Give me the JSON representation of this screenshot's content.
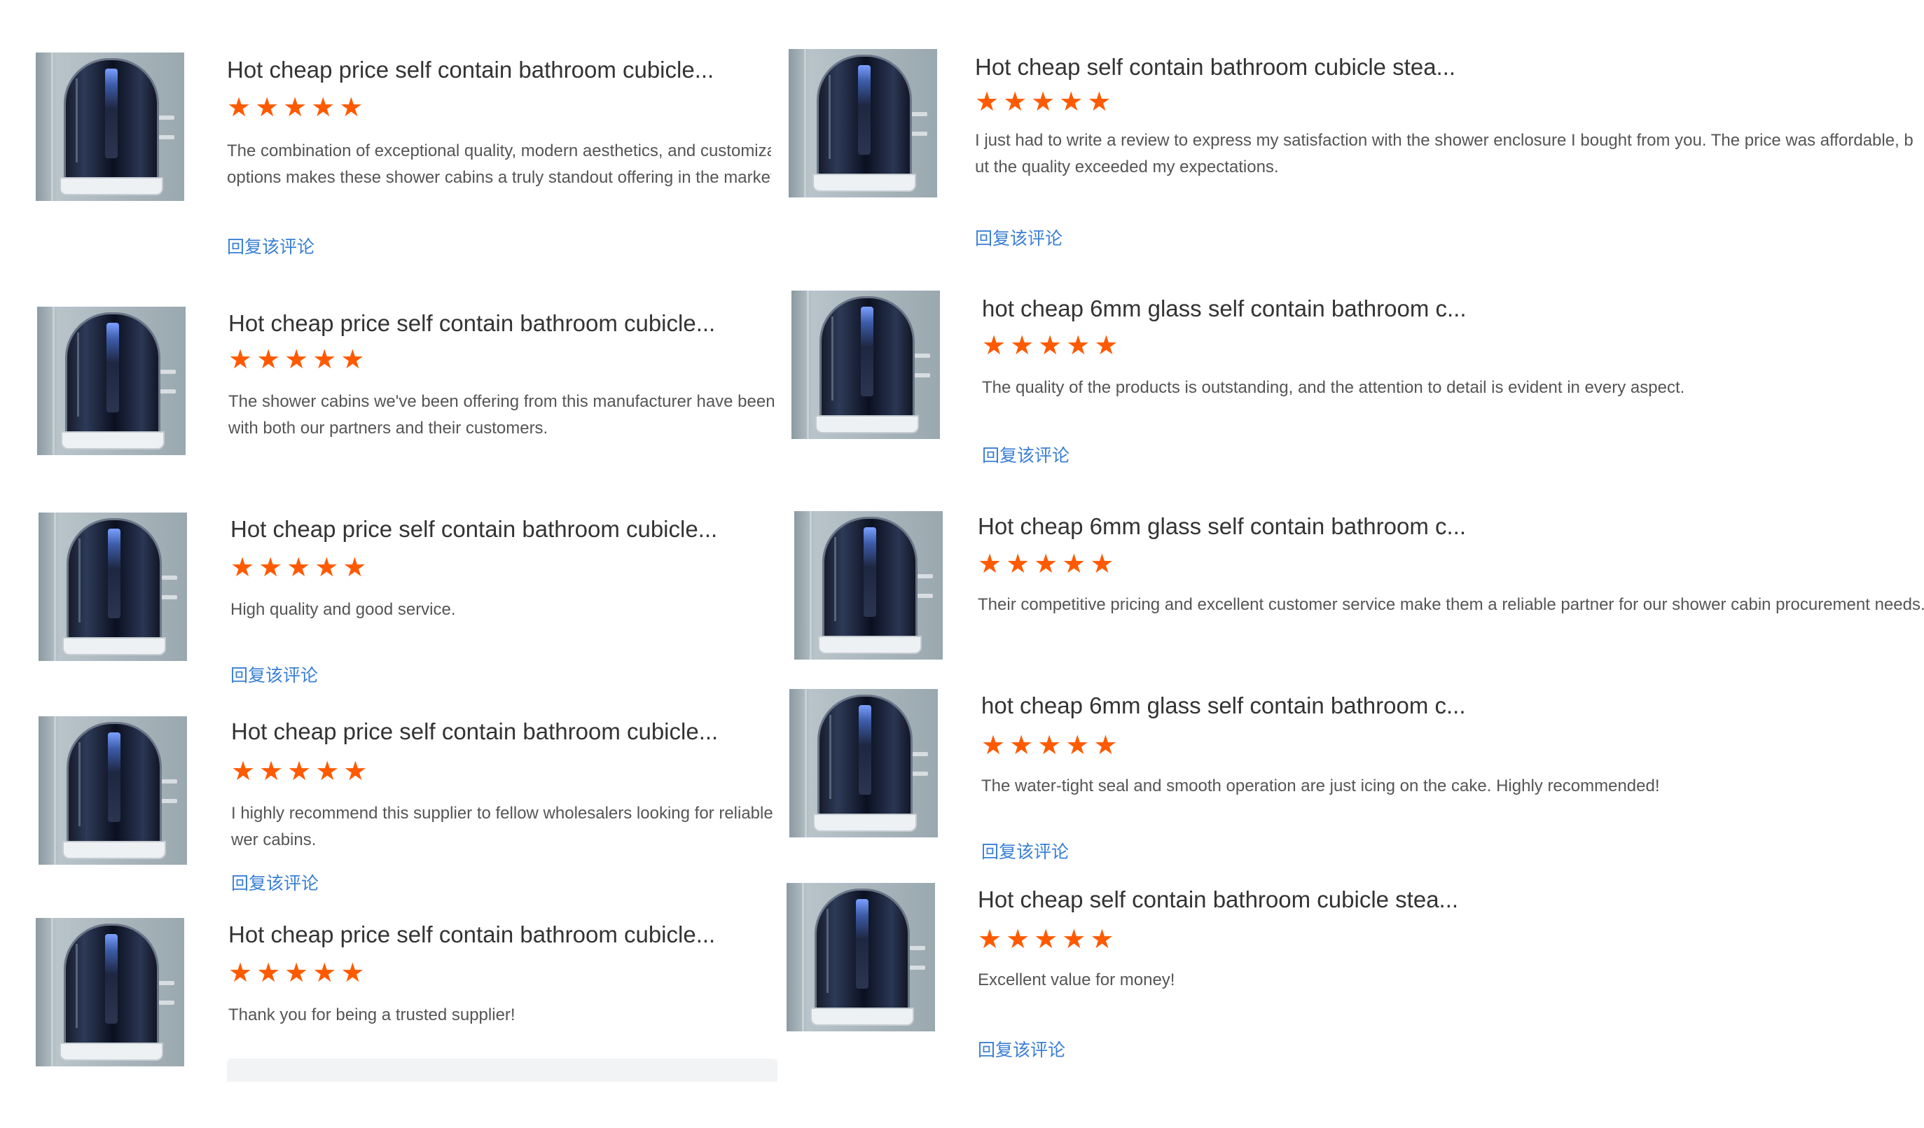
{
  "reviews": [
    {
      "title": "Hot cheap price self contain bathroom cubicle...",
      "stars": "★★★★★",
      "text": "The combination of exceptional quality, modern aesthetics, and customization options makes these shower cabins a truly standout offering in the market.",
      "reply": "回复该评论"
    },
    {
      "title": "Hot cheap self contain bathroom cubicle stea...",
      "stars": "★★★★★",
      "text": "I just had to write a review to express my satisfaction with the shower enclosure I bought from you. The price was affordable, but the quality exceeded my expectations.",
      "reply": "回复该评论"
    },
    {
      "title": "Hot cheap price self contain bathroom cubicle...",
      "stars": "★★★★★",
      "text": "The shower cabins we've been offering from this manufacturer have been a hit with both our partners and their customers.",
      "reply": ""
    },
    {
      "title": "hot cheap 6mm glass self contain bathroom c...",
      "stars": "★★★★★",
      "text": "The quality of the products is outstanding, and the attention to detail is evident in every aspect.",
      "reply": "回复该评论"
    },
    {
      "title": "Hot cheap price self contain bathroom cubicle...",
      "stars": "★★★★★",
      "text": "High quality and good service.",
      "reply": "回复该评论"
    },
    {
      "title": "Hot cheap 6mm glass self contain bathroom c...",
      "stars": "★★★★★",
      "text": "Their competitive pricing and excellent customer service make them a reliable partner for our shower cabin procurement needs.",
      "reply": ""
    },
    {
      "title": "Hot cheap price self contain bathroom cubicle...",
      "stars": "★★★★★",
      "text": "I highly recommend this supplier to fellow wholesalers looking for reliable shower cabins.",
      "reply": "回复该评论"
    },
    {
      "title": "hot cheap 6mm glass self contain bathroom c...",
      "stars": "★★★★★",
      "text": "The water-tight seal and smooth operation are just icing on the cake. Highly recommended!",
      "reply": "回复该评论"
    },
    {
      "title": "Hot cheap price self contain bathroom cubicle...",
      "stars": "★★★★★",
      "text": "Thank you for being a trusted supplier!",
      "reply": ""
    },
    {
      "title": "Hot cheap self contain bathroom cubicle stea...",
      "stars": "★★★★★",
      "text": "Excellent value for money!",
      "reply": "回复该评论"
    }
  ],
  "colors": {
    "star": "#ff5a00",
    "link": "#3a7fd6",
    "title": "#333333",
    "text": "#555555"
  },
  "icons": {
    "rating": "star-icon",
    "product": "shower-cabin-thumbnail"
  }
}
